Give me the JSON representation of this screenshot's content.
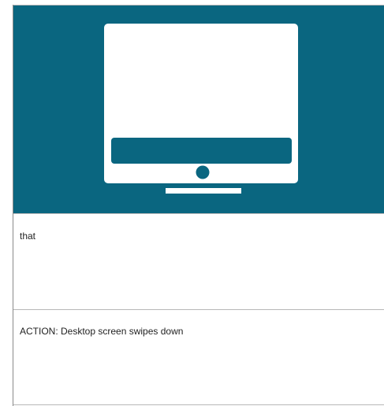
{
  "illustration": {
    "icon": "desktop-monitor-icon",
    "background_color": "#0a6680",
    "monitor_color": "#ffffff"
  },
  "panels": [
    {
      "text": "that"
    },
    {
      "text": "ACTION: Desktop screen swipes down"
    }
  ]
}
